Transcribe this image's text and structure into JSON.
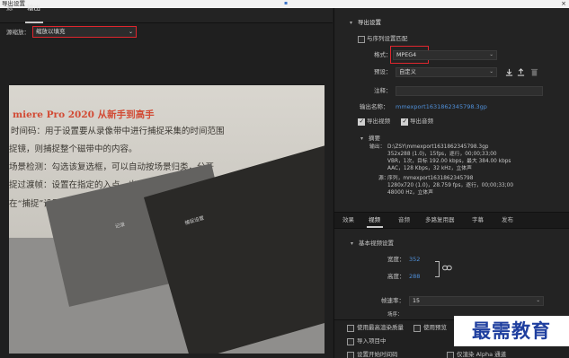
{
  "window": {
    "title": "导出设置",
    "close_label": "×"
  },
  "left": {
    "tabs": [
      {
        "label": "源"
      },
      {
        "label": "输出"
      }
    ],
    "source_scale": {
      "label": "源缩放：",
      "value": "缩放以填充"
    },
    "preview": {
      "heading": "miere Pro 2020 从新手到高手",
      "lines": [
        "时间码：用于设置要从录像带中进行捕捉采集的时间范围",
        "捉镜，则捕捉整个磁带中的内容。",
        "场景检测：勾选该复选框，可以自动按场景归类，分开",
        "捉过渡帧：设置在指定的入点、出点范围之外采集的帧数",
        "在“捕捉”设置面板中单击“设置”按钮，切换到“设"
      ],
      "screen_texts": [
        "捕捉设置",
        "记录"
      ]
    }
  },
  "right": {
    "export_settings": {
      "heading": "导出设置",
      "match_sequence_label": "与序列设置匹配",
      "format_label": "格式：",
      "format_value": "MPEG4",
      "preset_label": "预设：",
      "preset_value": "自定义",
      "comment_label": "注释：",
      "output_name_label": "输出名称：",
      "output_name_value": "mmexport1631862345798.3gp",
      "export_video_label": "导出视频",
      "export_audio_label": "导出音频"
    },
    "summary": {
      "heading": "摘要",
      "output_label": "输出：",
      "output_lines": [
        "D:\\ZSY\\mmexport1631862345798.3gp",
        "352x288 (1.0)，15fps，逐行，00;00;33;00",
        "VBR，1次，目标 192.00 kbps，最大 384.00 kbps",
        "AAC，128 Kbps，32  kHz，立体声"
      ],
      "source_label": "源：",
      "source_lines": [
        "序列，mmexport1631862345798",
        "1280x720 (1.0)，28.759 fps，逐行，00;00;33;00",
        "48000 Hz，立体声"
      ]
    },
    "subtabs": [
      {
        "label": "效果"
      },
      {
        "label": "视频"
      },
      {
        "label": "音频"
      },
      {
        "label": "多路复用器"
      },
      {
        "label": "字幕"
      },
      {
        "label": "发布"
      }
    ],
    "basic_video": {
      "heading": "基本视频设置",
      "width_label": "宽度：",
      "width_value": "352",
      "height_label": "高度：",
      "height_value": "288",
      "frame_rate_label": "帧速率：",
      "frame_rate_value": "15",
      "extra_label": "场序："
    },
    "bottom": {
      "max_render_quality_label": "使用最高渲染质量",
      "use_preview_label": "使用预览",
      "import_project_label": "导入项目中",
      "start_timecode_label": "设置开始时间码",
      "alpha_label": "仅渲染 Alpha 通道"
    }
  },
  "watermark": {
    "text": "最需教育"
  },
  "colors": {
    "highlight": "#e0262e",
    "link": "#4f8fd8",
    "watermark": "#1f3f9f"
  }
}
